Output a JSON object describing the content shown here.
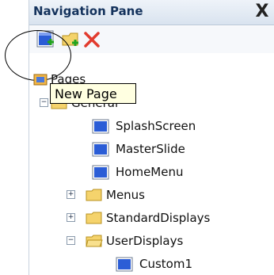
{
  "pane": {
    "title": "Navigation Pane",
    "close_glyph": "X"
  },
  "toolbar": {
    "buttons": [
      {
        "name": "new-page",
        "icon": "new-page-icon"
      },
      {
        "name": "new-folder",
        "icon": "new-folder-icon"
      },
      {
        "name": "delete",
        "icon": "delete-x-icon"
      }
    ]
  },
  "tooltip": {
    "text": "New Page"
  },
  "tree": {
    "root": {
      "label": "Pages"
    },
    "general": {
      "label": "General"
    },
    "items": [
      {
        "label": "SplashScreen",
        "type": "page"
      },
      {
        "label": "MasterSlide",
        "type": "page"
      },
      {
        "label": "HomeMenu",
        "type": "page"
      },
      {
        "label": "Menus",
        "type": "folder",
        "expander": "+"
      },
      {
        "label": "StandardDisplays",
        "type": "folder",
        "expander": "+"
      },
      {
        "label": "UserDisplays",
        "type": "folder",
        "expander": "−"
      },
      {
        "label": "Custom1",
        "type": "page"
      }
    ]
  },
  "colors": {
    "accent": "#2b5dd6",
    "folder": "#f2c94c",
    "delete": "#e23b2e"
  }
}
